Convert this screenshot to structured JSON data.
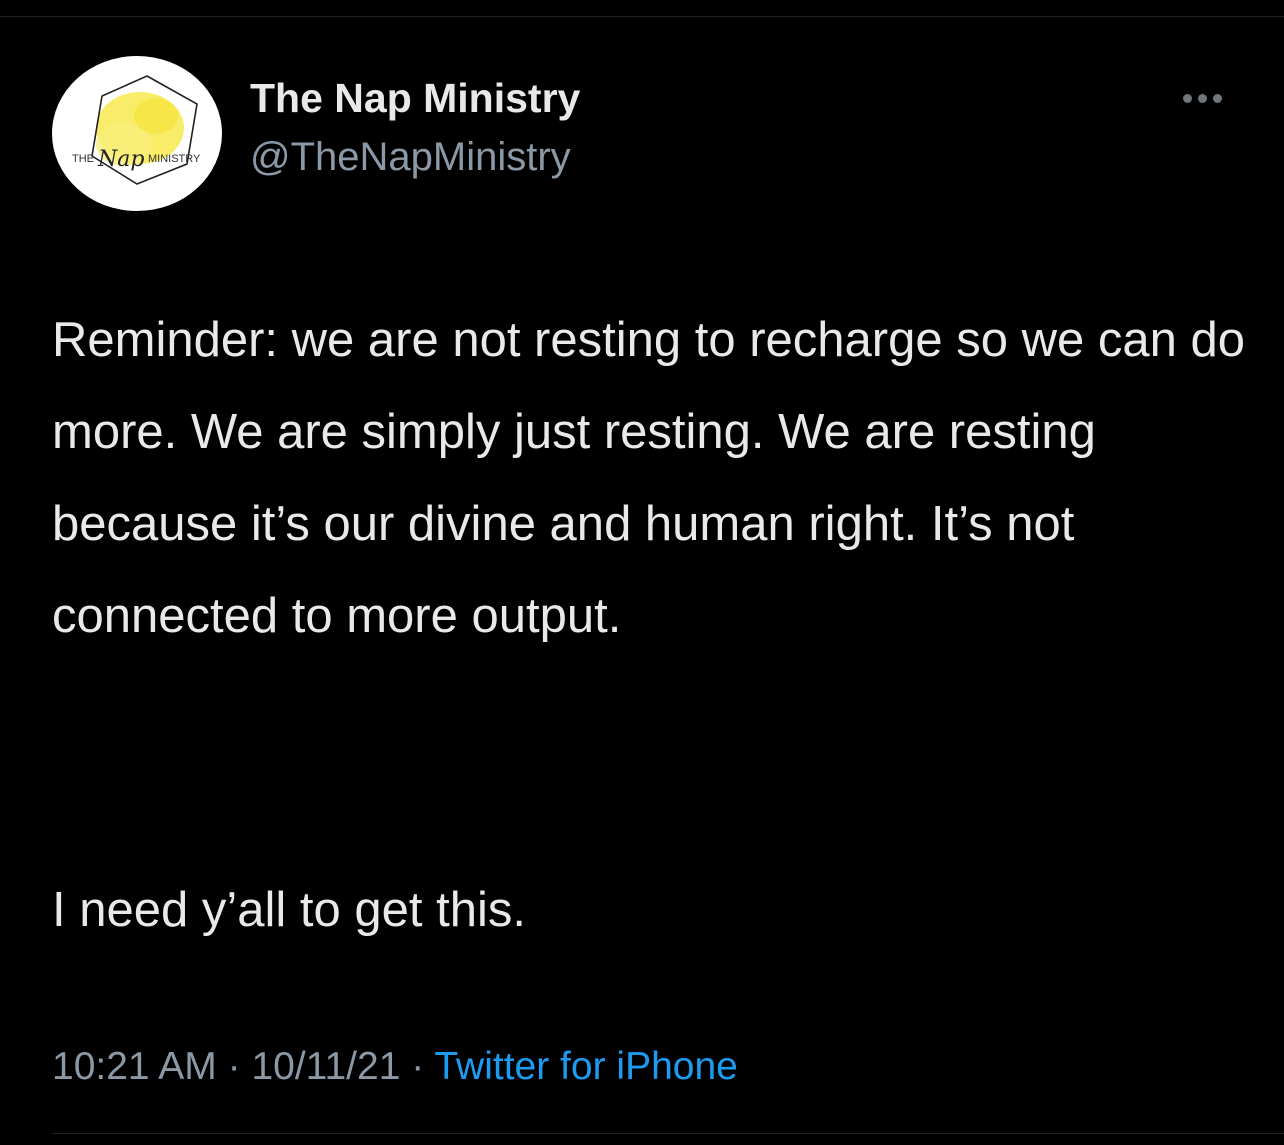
{
  "tweet": {
    "author_name": "The Nap Ministry",
    "author_handle": "@TheNapMinistry",
    "avatar": {
      "logo_word_left": "THE",
      "logo_word_script": "Nap",
      "logo_word_right": "MINISTRY",
      "accent_color": "#f7e94f"
    },
    "more_icon": "more-horizontal-icon",
    "body_paragraph_1": "Reminder: we are not resting to recharge so we can do more. We are simply just resting. We are resting because it’s our divine and human right. It’s not connected to more output.",
    "body_paragraph_2": "I need y’all to get this.",
    "time": "10:21 AM",
    "separator": "·",
    "date": "10/11/21",
    "source": "Twitter for iPhone",
    "colors": {
      "background": "#000000",
      "primary_text": "#e7e9ea",
      "secondary_text": "#8b98a5",
      "link": "#1d9bf0"
    }
  }
}
